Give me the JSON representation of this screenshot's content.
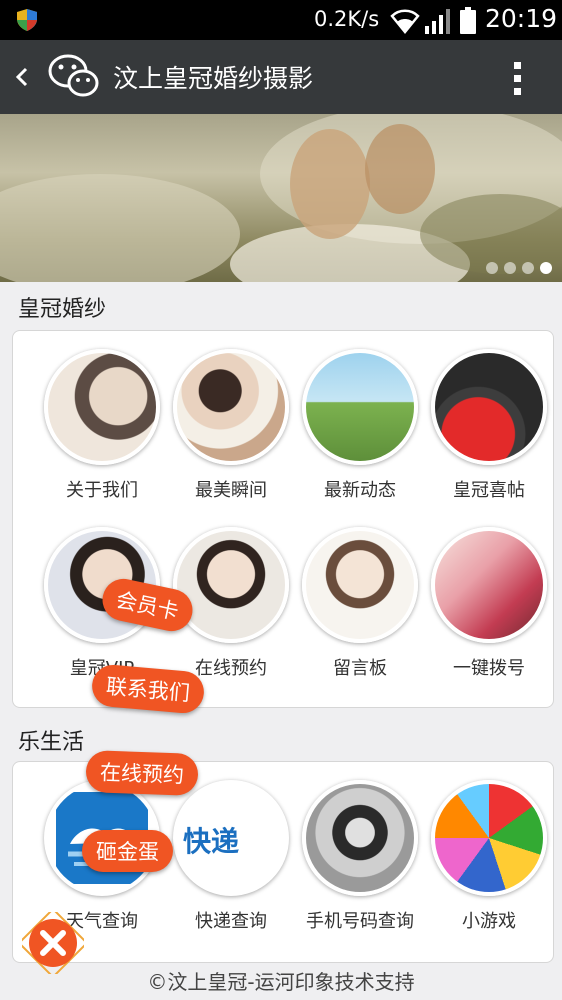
{
  "status_bar": {
    "net_speed": "0.2K/s",
    "time": "20:19"
  },
  "header": {
    "title": "汶上皇冠婚纱摄影"
  },
  "sections": [
    {
      "title": "皇冠婚纱",
      "items": [
        {
          "label": "关于我们"
        },
        {
          "label": "最美瞬间"
        },
        {
          "label": "最新动态"
        },
        {
          "label": "皇冠喜帖"
        },
        {
          "label": "皇冠VIP"
        },
        {
          "label": "在线预约"
        },
        {
          "label": "留言板"
        },
        {
          "label": "一键拨号"
        }
      ]
    },
    {
      "title": "乐生活",
      "items": [
        {
          "label": "天气查询"
        },
        {
          "label": "快递查询",
          "logo_text": "快递"
        },
        {
          "label": "手机号码查询"
        },
        {
          "label": "小游戏"
        }
      ]
    }
  ],
  "floating_menu": [
    {
      "label": "会员卡"
    },
    {
      "label": "联系我们"
    },
    {
      "label": "在线预约"
    },
    {
      "label": "砸金蛋"
    }
  ],
  "footer": {
    "text": "©汶上皇冠-运河印象技术支持"
  },
  "colors": {
    "accent": "#f05523",
    "titlebar": "#36393b"
  },
  "icons": [
    "shield-icon",
    "wifi-icon",
    "signal-icon",
    "battery-icon",
    "back-icon",
    "wechat-icon",
    "more-icon",
    "close-icon"
  ]
}
